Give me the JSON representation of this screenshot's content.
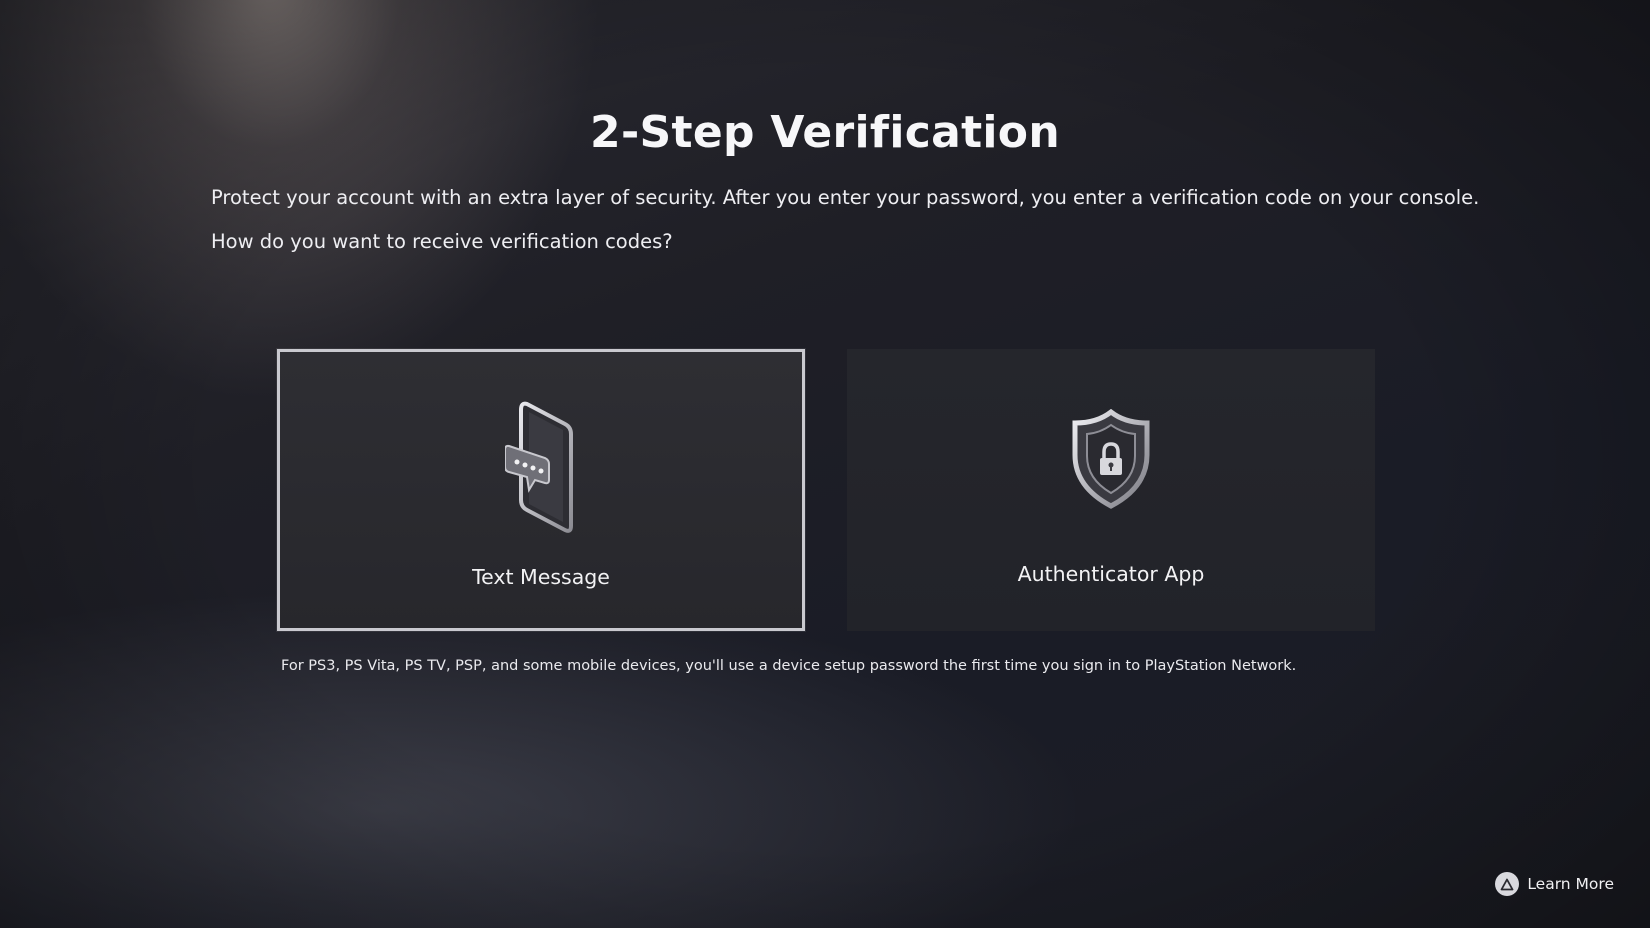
{
  "page": {
    "title": "2-Step Verification",
    "description": "Protect your account with an extra layer of security. After you enter your password, you enter a verification code on your console.",
    "question": "How do you want to receive verification codes?"
  },
  "options": [
    {
      "label": "Text Message",
      "icon": "phone-message-icon",
      "selected": true
    },
    {
      "label": "Authenticator App",
      "icon": "shield-lock-icon",
      "selected": false
    }
  ],
  "note": "For PS3, PS Vita, PS TV, PSP, and some mobile devices, you'll use a device setup password the first time you sign in to PlayStation Network.",
  "footer": {
    "learn_more_label": "Learn More",
    "learn_more_icon": "triangle-button-icon"
  },
  "colors": {
    "selection_border": "#c9c9cf",
    "text": "#f2f2f4",
    "background": "#1f1f26"
  }
}
